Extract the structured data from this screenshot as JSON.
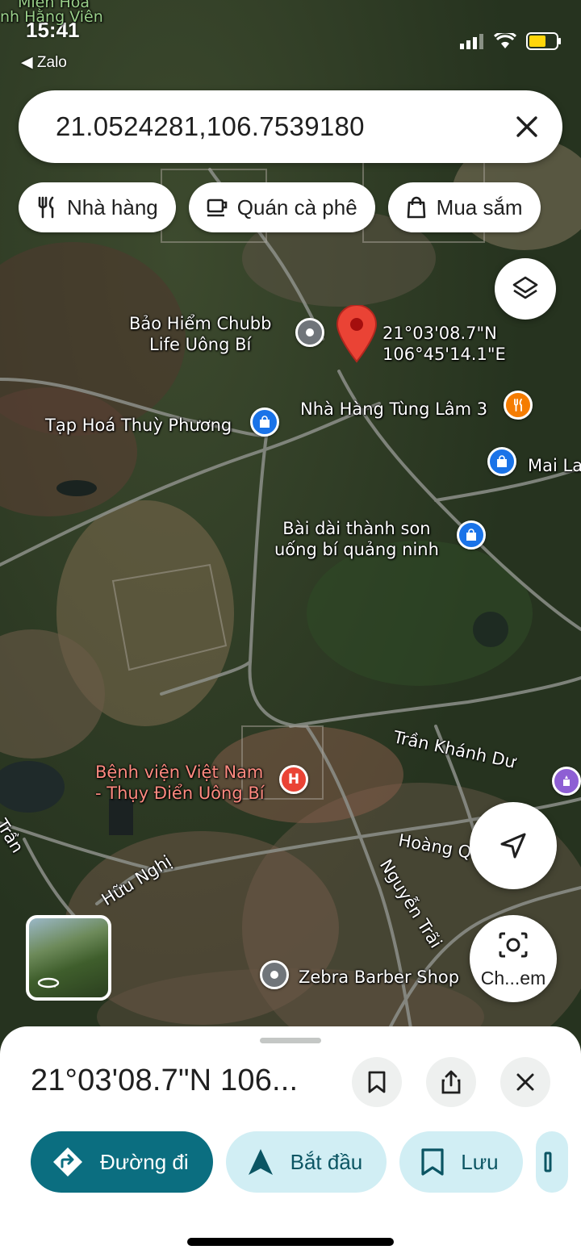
{
  "status_bar": {
    "time": "15:41",
    "back_app": "◀ Zalo",
    "top_partial_labels": [
      "Miền Hoa",
      "nh Hằng Viên"
    ]
  },
  "search": {
    "query": "21.0524281,106.7539180",
    "clear_icon": "close-icon"
  },
  "chips": [
    {
      "label": "Nhà hàng",
      "icon": "utensils-icon"
    },
    {
      "label": "Quán cà phê",
      "icon": "coffee-icon"
    },
    {
      "label": "Mua sắm",
      "icon": "shopping-bag-icon"
    }
  ],
  "map": {
    "dropped_pin": {
      "line1": "21°03'08.7\"N",
      "line2": "106°45'14.1\"E"
    },
    "places": {
      "chubb_1": "Bảo Hiểm Chubb",
      "chubb_2": "Life Uông Bí",
      "tap_hoa": "Tạp Hoá Thuỳ Phương",
      "nha_hang": "Nhà Hàng Tùng Lâm 3",
      "mai_la": "Mai La",
      "bai_dai_1": "Bài dài thành son",
      "bai_dai_2": "uống bí quảng ninh",
      "hospital_1": "Bệnh viện Việt Nam",
      "hospital_2": "- Thụy Điển Uông Bí",
      "zebra": "Zebra Barber Shop"
    },
    "roads": {
      "tran_khanh_du": "Trần Khánh Dư",
      "hoang_q": "Hoàng Q",
      "nguyen_trai": "Nguyễn Trãi",
      "huu_nghi": "Hữu Nghị",
      "tran": "Trần"
    },
    "lens_label": "Ch...em"
  },
  "colors": {
    "accent": "#0b6e80",
    "accent_light": "#d1eef4",
    "pin_red": "#ea4335",
    "poi_blue": "#1a73e8",
    "poi_orange": "#f57c00"
  },
  "sheet": {
    "title": "21°03'08.7\"N 106...",
    "actions": [
      {
        "label": "Đường đi",
        "icon": "directions-icon"
      },
      {
        "label": "Bắt đầu",
        "icon": "navigation-icon"
      },
      {
        "label": "Lưu",
        "icon": "bookmark-icon"
      }
    ]
  }
}
